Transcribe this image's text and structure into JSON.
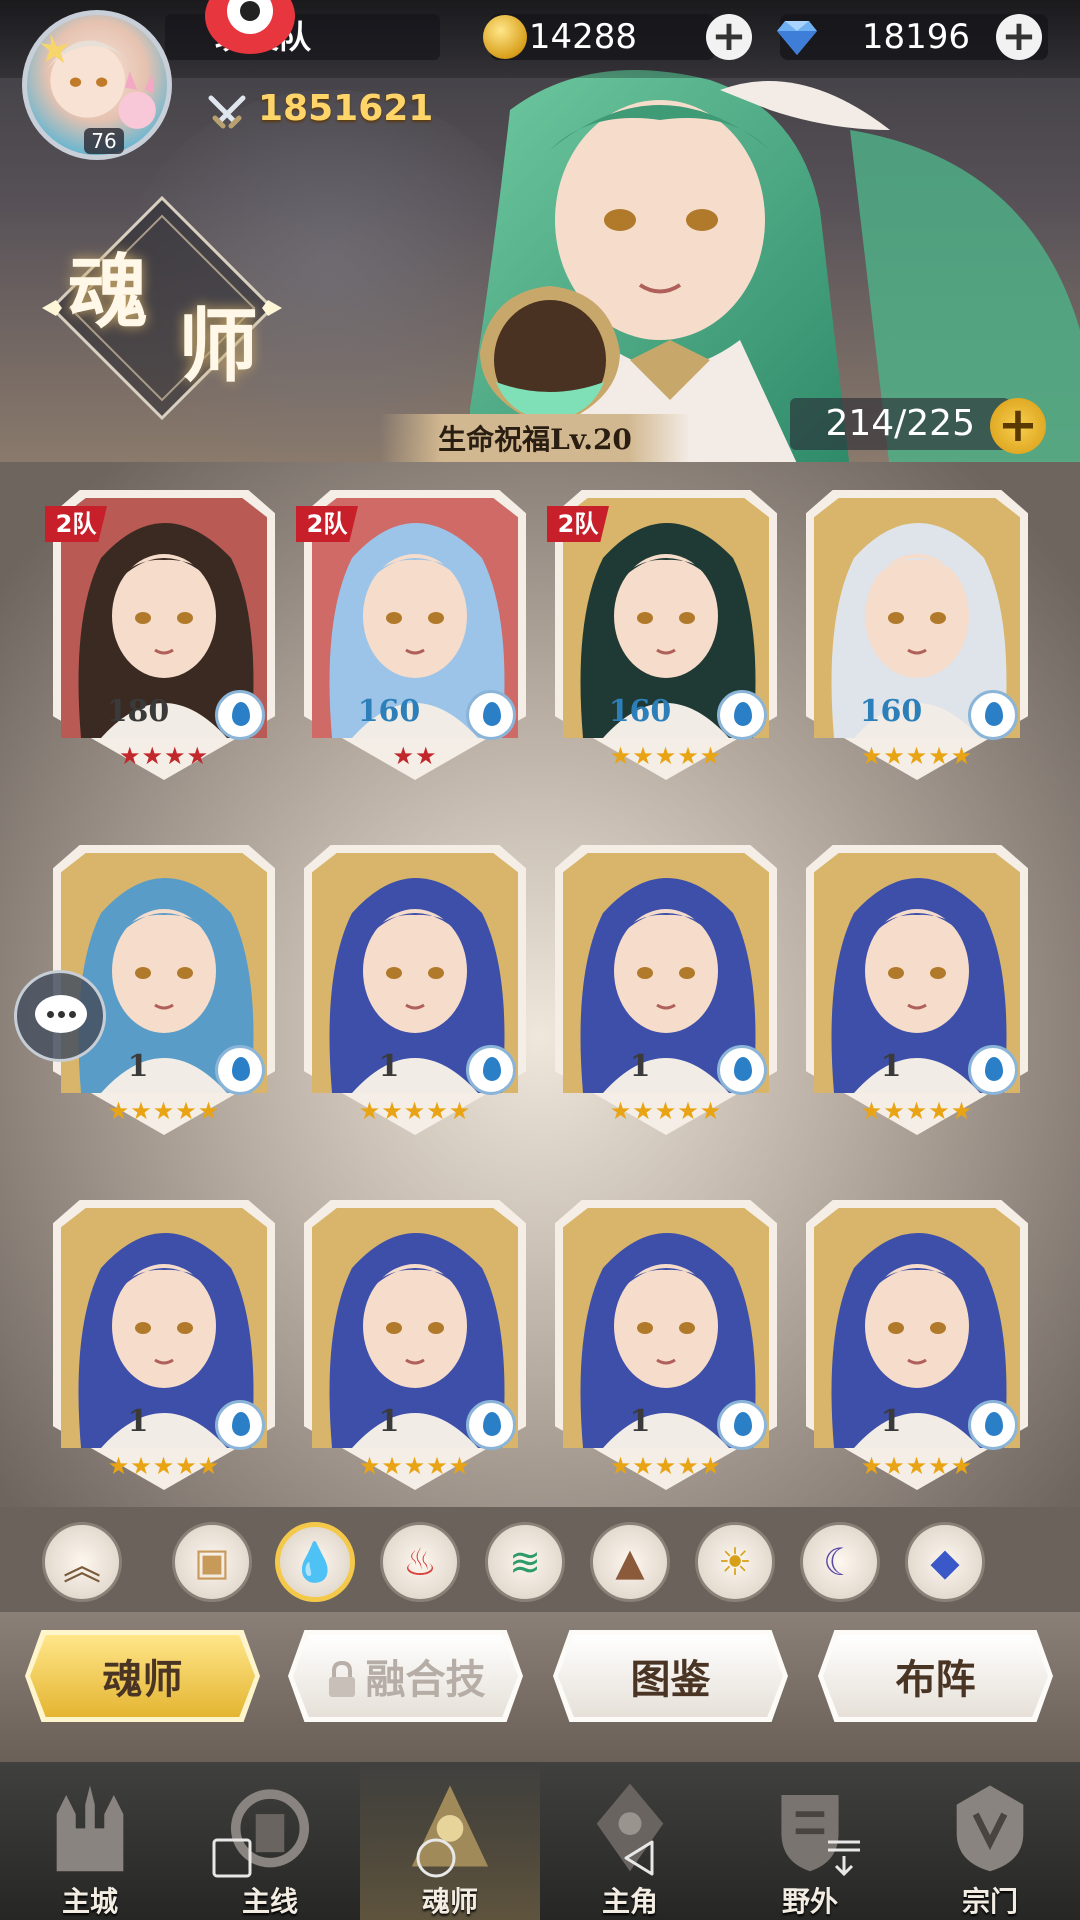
{
  "header": {
    "team_name": "玩火队",
    "player_level": "76",
    "battle_power": "1851621",
    "gold": "14288",
    "diamonds": "18196"
  },
  "section": {
    "title_1": "魂",
    "title_2": "师",
    "life_blessing": "生命祝福Lv.20",
    "capacity": "214/225"
  },
  "cards": [
    {
      "level": "180",
      "stars": "★★★★",
      "star_color": "red",
      "team": "2队",
      "level_color": "dark",
      "hair": "#3a2a22",
      "bg": "#b95a54"
    },
    {
      "level": "160",
      "stars": "★★",
      "star_color": "red",
      "team": "2队",
      "level_color": "blue",
      "hair": "#9cc4e8",
      "bg": "#cf6a66"
    },
    {
      "level": "160",
      "stars": "★★★★★",
      "star_color": "gold",
      "team": "2队",
      "level_color": "blue",
      "hair": "#1f3a34",
      "bg": "#d8b56a"
    },
    {
      "level": "160",
      "stars": "★★★★★",
      "star_color": "gold",
      "team": "",
      "level_color": "blue",
      "hair": "#dfe3ea",
      "bg": "#d8b56a"
    },
    {
      "level": "1",
      "stars": "★★★★★",
      "star_color": "gold",
      "team": "",
      "level_color": "dark",
      "hair": "#5a9cc8",
      "bg": "#d8b56a"
    },
    {
      "level": "1",
      "stars": "★★★★★",
      "star_color": "gold",
      "team": "",
      "level_color": "dark",
      "hair": "#3d4fa8",
      "bg": "#d8b56a"
    },
    {
      "level": "1",
      "stars": "★★★★★",
      "star_color": "gold",
      "team": "",
      "level_color": "dark",
      "hair": "#3d4fa8",
      "bg": "#d8b56a"
    },
    {
      "level": "1",
      "stars": "★★★★★",
      "star_color": "gold",
      "team": "",
      "level_color": "dark",
      "hair": "#3d4fa8",
      "bg": "#d8b56a"
    },
    {
      "level": "1",
      "stars": "★★★★★",
      "star_color": "gold",
      "team": "",
      "level_color": "dark",
      "hair": "#3d4fa8",
      "bg": "#d8b56a"
    },
    {
      "level": "1",
      "stars": "★★★★★",
      "star_color": "gold",
      "team": "",
      "level_color": "dark",
      "hair": "#3d4fa8",
      "bg": "#d8b56a"
    },
    {
      "level": "1",
      "stars": "★★★★★",
      "star_color": "gold",
      "team": "",
      "level_color": "dark",
      "hair": "#3d4fa8",
      "bg": "#d8b56a"
    },
    {
      "level": "1",
      "stars": "★★★★★",
      "star_color": "gold",
      "team": "",
      "level_color": "dark",
      "hair": "#3d4fa8",
      "bg": "#d8b56a"
    }
  ],
  "filters": [
    {
      "icon": "chevron-up-icon",
      "glyph": "︽",
      "color": "#7a5a3a"
    },
    {
      "icon": "box-icon",
      "glyph": "▣",
      "color": "#c89a5a"
    },
    {
      "icon": "water-icon",
      "glyph": "💧",
      "color": "#2a7fc7"
    },
    {
      "icon": "fire-icon",
      "glyph": "♨",
      "color": "#d8403a"
    },
    {
      "icon": "wind-icon",
      "glyph": "≋",
      "color": "#2f9a6a"
    },
    {
      "icon": "earth-icon",
      "glyph": "▲",
      "color": "#8a5a3a"
    },
    {
      "icon": "light-icon",
      "glyph": "☀",
      "color": "#d8a018"
    },
    {
      "icon": "dark-icon",
      "glyph": "☾",
      "color": "#5a4aa8"
    },
    {
      "icon": "special-icon",
      "glyph": "◆",
      "color": "#3a58c8"
    }
  ],
  "tabs": [
    "魂师",
    "融合技",
    "图鉴",
    "布阵"
  ],
  "nav": [
    "主城",
    "主线",
    "魂师",
    "主角",
    "野外",
    "宗门"
  ]
}
